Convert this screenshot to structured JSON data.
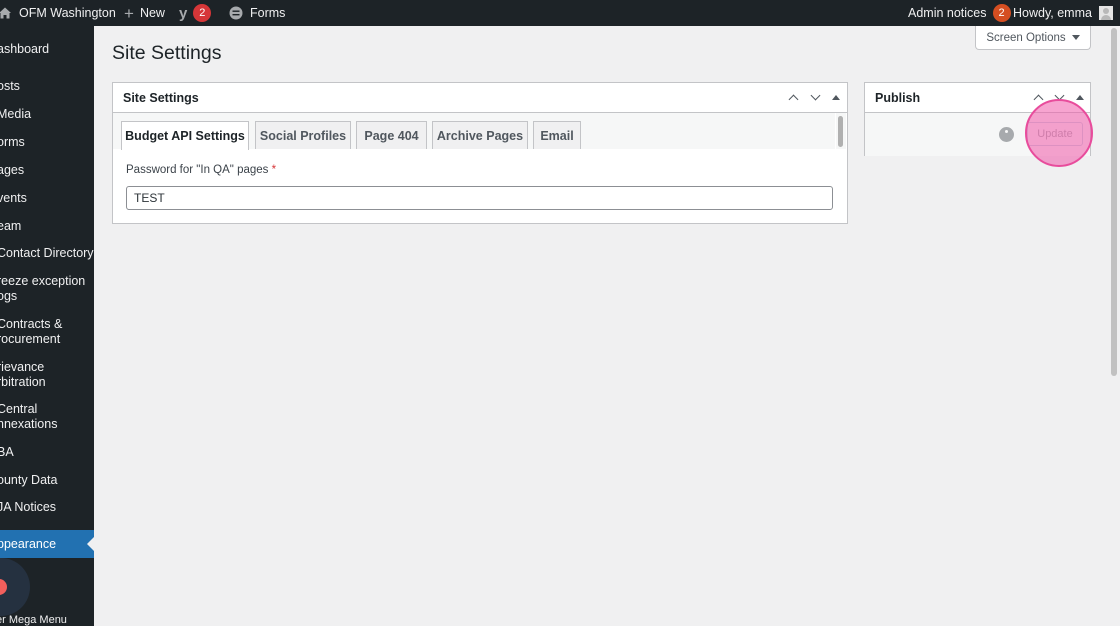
{
  "adminbar": {
    "site_name": "OFM Washington",
    "new_label": "New",
    "yoast_count": "2",
    "forms_label": "Forms",
    "admin_notices_label": "Admin notices",
    "admin_notices_count": "2",
    "howdy": "Howdy, emma"
  },
  "sidebar": {
    "items": [
      {
        "label": "ashboard"
      },
      {
        "label": "osts"
      },
      {
        "label": "Media"
      },
      {
        "label": "orms"
      },
      {
        "label": "ages"
      },
      {
        "label": "vents"
      },
      {
        "label": "eam"
      },
      {
        "label": "Contact Directory"
      },
      {
        "label": "reeze exception\nogs"
      },
      {
        "label": "Contracts &\nrocurement"
      },
      {
        "label": "rievance\nrbitration"
      },
      {
        "label": "Central\nnnexations"
      },
      {
        "label": "BA"
      },
      {
        "label": "ounty Data"
      },
      {
        "label": "JA Notices"
      },
      {
        "label": "ppearance"
      }
    ],
    "mega_menu_label": "er Mega Menu"
  },
  "screen_options": "Screen Options",
  "page_title": "Site Settings",
  "settings_box": {
    "title": "Site Settings",
    "tabs": [
      {
        "label": "Budget API Settings",
        "active": true
      },
      {
        "label": "Social Profiles",
        "active": false
      },
      {
        "label": "Page 404",
        "active": false
      },
      {
        "label": "Archive Pages",
        "active": false
      },
      {
        "label": "Email",
        "active": false
      }
    ],
    "field_label": "Password for \"In QA\" pages",
    "required_mark": "*",
    "field_value": "TEST"
  },
  "publish_box": {
    "title": "Publish",
    "update_label": "Update"
  },
  "colors": {
    "admin_bar": "#1d2327",
    "accent": "#2271b1",
    "badge": "#d63638",
    "highlight": "#f05aaa"
  }
}
